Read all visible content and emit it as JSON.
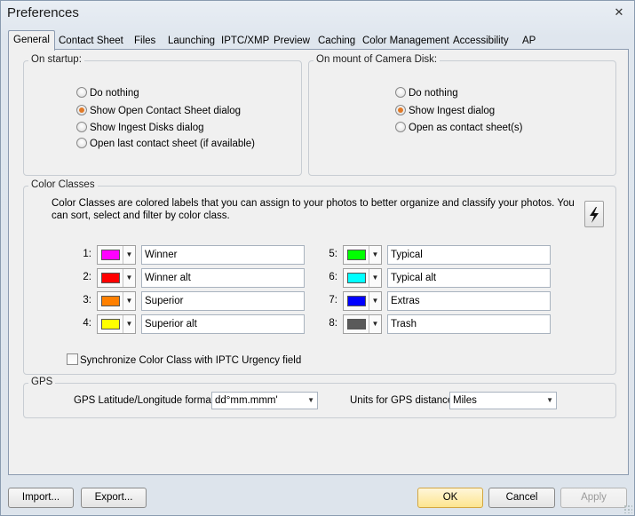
{
  "window": {
    "title": "Preferences",
    "close_glyph": "✕"
  },
  "tabs": [
    {
      "label": "General",
      "active": true
    },
    {
      "label": "Contact Sheet"
    },
    {
      "label": "Files"
    },
    {
      "label": "Launching"
    },
    {
      "label": "IPTC/XMP"
    },
    {
      "label": "Preview"
    },
    {
      "label": "Caching"
    },
    {
      "label": "Color Management"
    },
    {
      "label": "Accessibility"
    },
    {
      "label": "AP"
    }
  ],
  "startup": {
    "label": "On startup:",
    "options": [
      {
        "label": "Do nothing",
        "checked": false
      },
      {
        "label": "Show Open Contact Sheet dialog",
        "checked": true
      },
      {
        "label": "Show Ingest Disks dialog",
        "checked": false
      },
      {
        "label": "Open last contact sheet (if available)",
        "checked": false
      }
    ]
  },
  "camera_disk": {
    "label": "On mount of Camera Disk:",
    "options": [
      {
        "label": "Do nothing",
        "checked": false
      },
      {
        "label": "Show Ingest dialog",
        "checked": true
      },
      {
        "label": "Open as contact sheet(s)",
        "checked": false
      }
    ]
  },
  "color_classes": {
    "label": "Color Classes",
    "description": "Color Classes are colored labels that you can assign to your photos to better organize and classify your photos.  You can sort, select and filter by color class.",
    "action_icon": "lightning-icon",
    "items": [
      {
        "num": "1:",
        "color": "#ff00ff",
        "name": "Winner"
      },
      {
        "num": "2:",
        "color": "#ff0000",
        "name": "Winner alt"
      },
      {
        "num": "3:",
        "color": "#ff8000",
        "name": "Superior"
      },
      {
        "num": "4:",
        "color": "#ffff00",
        "name": "Superior alt"
      },
      {
        "num": "5:",
        "color": "#00ff00",
        "name": "Typical"
      },
      {
        "num": "6:",
        "color": "#00ffff",
        "name": "Typical alt"
      },
      {
        "num": "7:",
        "color": "#0000ff",
        "name": "Extras"
      },
      {
        "num": "8:",
        "color": "#5a5a5a",
        "name": "Trash"
      }
    ],
    "sync_label": "Synchronize Color Class with IPTC Urgency field",
    "sync_checked": false
  },
  "gps": {
    "label": "GPS",
    "format_label": "GPS Latitude/Longitude format:",
    "format_value": "dd°mm.mmm'",
    "units_label": "Units for GPS distance:",
    "units_value": "Miles"
  },
  "buttons": {
    "import": "Import...",
    "export": "Export...",
    "ok": "OK",
    "cancel": "Cancel",
    "apply": "Apply"
  }
}
